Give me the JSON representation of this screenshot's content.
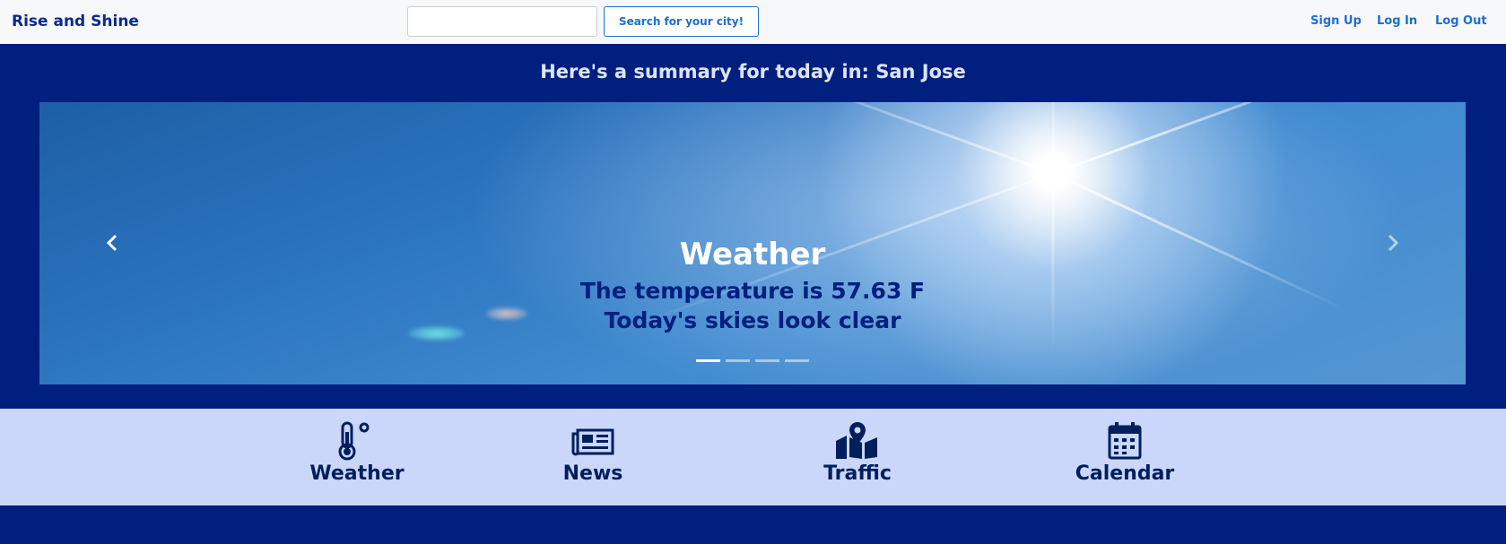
{
  "navbar": {
    "brand": "Rise and Shine",
    "search_placeholder": "",
    "search_button": "Search for your city!",
    "links": [
      "Sign Up",
      "Log In",
      "Log Out"
    ]
  },
  "summary": {
    "headline": "Here's a summary for today in: San Jose"
  },
  "carousel": {
    "slide_title": "Weather",
    "line1": "The temperature is 57.63 F",
    "line2": "Today's skies look clear",
    "indicator_count": 4,
    "active_indicator": 0,
    "prev_icon": "chevron-left-icon",
    "next_icon": "chevron-right-icon"
  },
  "features": [
    {
      "label": "Weather",
      "icon": "thermometer-icon"
    },
    {
      "label": "News",
      "icon": "newspaper-icon"
    },
    {
      "label": "Traffic",
      "icon": "map-marker-icon"
    },
    {
      "label": "Calendar",
      "icon": "calendar-icon"
    }
  ],
  "colors": {
    "page_bg": "#001f7e",
    "navbar_bg": "#f7f8fa",
    "accent": "#1b6ed2",
    "feature_bar_bg": "#cad7fa",
    "icon_color": "#001f5c"
  }
}
